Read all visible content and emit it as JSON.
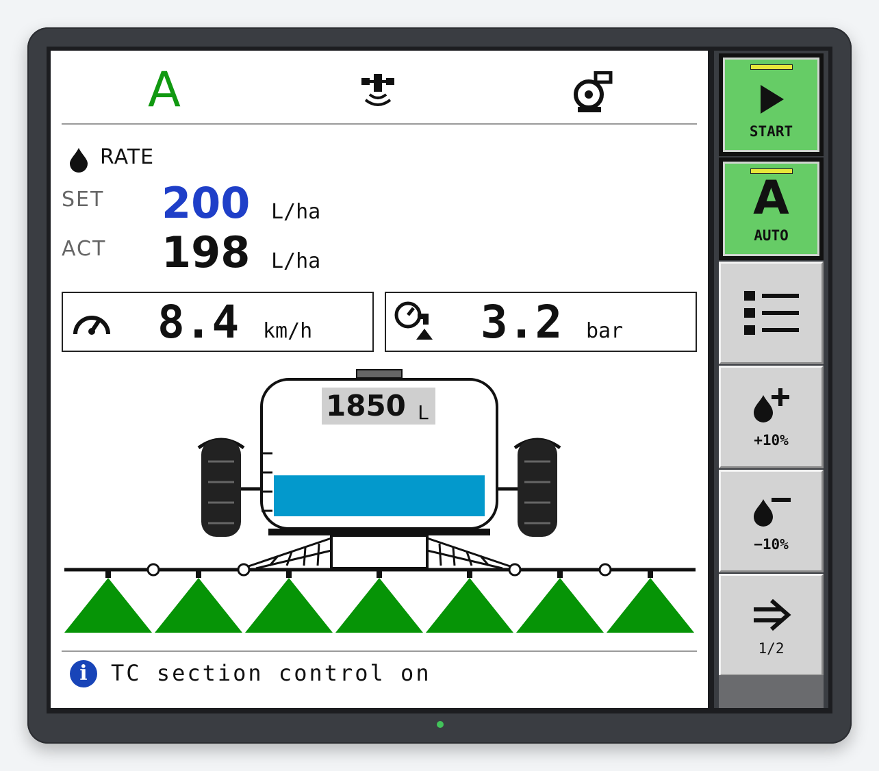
{
  "status_bar": {
    "mode_letter": "A",
    "icons": [
      "auto-mode-icon",
      "gps-antenna-icon",
      "pump-icon"
    ]
  },
  "rate": {
    "title": "RATE",
    "set_label": "SET",
    "set_value": "200",
    "set_unit": "L/ha",
    "act_label": "ACT",
    "act_value": "198",
    "act_unit": "L/ha"
  },
  "speed": {
    "value": "8.4",
    "unit": "km/h",
    "icon": "speedometer-icon"
  },
  "pressure": {
    "value": "3.2",
    "unit": "bar",
    "icon": "pressure-gauge-icon"
  },
  "tank": {
    "volume": "1850",
    "unit": "L",
    "fill_fraction": 0.28
  },
  "boom": {
    "sections": 7,
    "sections_active": [
      true,
      true,
      true,
      true,
      true,
      true,
      true
    ]
  },
  "message": {
    "icon": "info-icon",
    "text": "TC section control on"
  },
  "softkeys": [
    {
      "id": "start",
      "label": "START",
      "icon": "play-icon",
      "active": true
    },
    {
      "id": "auto",
      "label": "AUTO",
      "icon": "auto-a-icon",
      "active": true
    },
    {
      "id": "menu",
      "label": "",
      "icon": "list-menu-icon",
      "active": false
    },
    {
      "id": "rate-plus",
      "label": "+10%",
      "icon": "drop-plus-icon",
      "active": false
    },
    {
      "id": "rate-minus",
      "label": "−10%",
      "icon": "drop-minus-icon",
      "active": false
    },
    {
      "id": "next-page",
      "label": "1/2",
      "icon": "arrow-right-icon",
      "active": false
    }
  ],
  "colors": {
    "accent_green": "#119911",
    "spray_green": "#069406",
    "set_blue": "#1f3fc8",
    "tank_liquid": "#0399cc",
    "softkey_active": "#66cc66",
    "softkey_idle": "#d3d3d3",
    "info_blue": "#1844b8"
  }
}
